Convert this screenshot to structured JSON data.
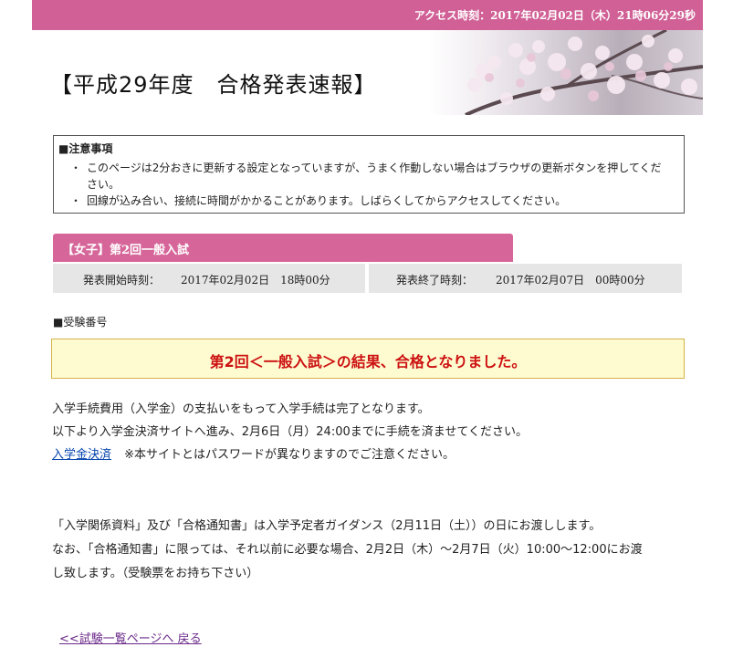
{
  "access": {
    "label": "アクセス時刻：2017年02月02日（木）21時06分29秒"
  },
  "header": {
    "title": "【平成29年度　合格発表速報】"
  },
  "notice": {
    "heading": "■注意事項",
    "items": [
      "このページは2分おきに更新する設定となっていますが、うまく作動しない場合はブラウザの更新ボタンを押してください。",
      "回線が込み合い、接続に時間がかかることがあります。しばらくしてからアクセスしてください。"
    ]
  },
  "exam": {
    "tab_label": "【女子】第2回一般入試",
    "start_label": "発表開始時刻：",
    "start_value": "2017年02月02日　18時00分",
    "end_label": "発表終了時刻：",
    "end_value": "2017年02月07日　00時00分"
  },
  "section": {
    "label": "■受験番号"
  },
  "result": {
    "text": "第2回＜一般入試＞の結果、合格となりました。"
  },
  "body": {
    "line1": "入学手続費用（入学金）の支払いをもって入学手続は完了となります。",
    "line2": "以下より入学金決済サイトへ進み、2月6日（月）24:00までに手続を済ませてください。",
    "link_label": "入学金決済",
    "link_note": "※本サイトとはパスワードが異なりますのでご注意ください。",
    "line3": "「入学関係資料」及び「合格通知書」は入学予定者ガイダンス（2月11日（土））の日にお渡しします。",
    "line4": "なお、「合格通知書」に限っては、それ以前に必要な場合、2月2日（木）～2月7日（火）10:00～12:00にお渡",
    "line5": "し致します。（受験票をお持ち下さい）"
  },
  "footer": {
    "back_label": "<<試験一覧ページへ 戻る"
  },
  "colors": {
    "brand_pink": "#d06095",
    "tab_pink": "#d66699",
    "result_red": "#cc1111",
    "result_bg": "#fffbd0",
    "link_blue": "#0645ad"
  }
}
